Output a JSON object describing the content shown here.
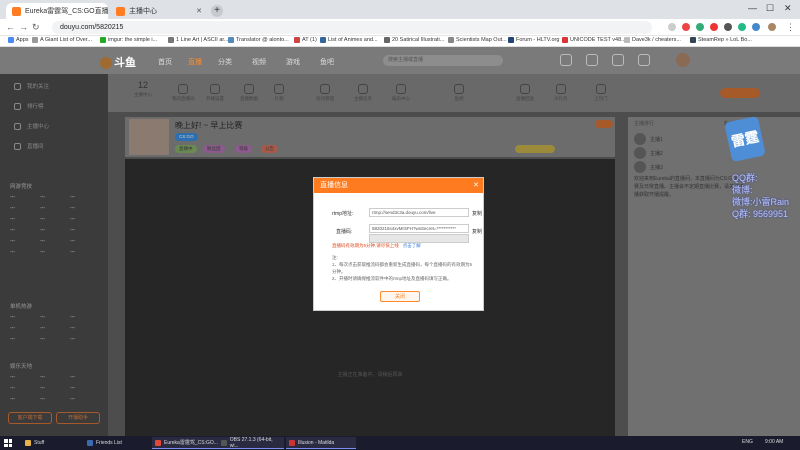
{
  "browser": {
    "tabs": [
      {
        "title": "Eureka雷霆驾_CS:GO直播_斗鱼直播",
        "active": true
      },
      {
        "title": "主播中心",
        "active": false
      }
    ],
    "new_tab": "+",
    "url": "douyu.com/5820215",
    "win_controls": [
      "—",
      "☐",
      "✕"
    ]
  },
  "bookmarks": [
    "Apps",
    "A Giant List of Over...",
    "imgur: the simple i...",
    "1 Line Art | ASCII ar...",
    "Translator @ alonto...",
    "AT (1)",
    "List of Animes and...",
    "20 Satirical Illustrati...",
    "Scientists Map Out...",
    "Forum - HLTV.org",
    "UNICODE TEST v48...",
    "Dave3k / cheaters...",
    "SteamRep » LoL Bo..."
  ],
  "site": {
    "logo": "斗鱼",
    "nav": [
      "首页",
      "直播",
      "分类",
      "视频",
      "游戏",
      "鱼吧"
    ],
    "search_placeholder": "搜索主播或直播"
  },
  "sidebar": {
    "items": [
      "我的关注",
      "排行榜",
      "主播中心",
      "直播间"
    ],
    "section_heads": [
      "网游竞技",
      "单机热游",
      "娱乐天地"
    ],
    "buttons": [
      "客户端下载",
      "开播助手"
    ]
  },
  "category_count": "12",
  "categories": [
    "主播中心",
    "我的直播间",
    "开播设置",
    "直播数据",
    "礼物",
    "房间管理",
    "主播任务",
    "娱乐中心",
    "鱼吧",
    "直播回放",
    "大礼包",
    "上热门"
  ],
  "room": {
    "title": "晚上好! ~ 早上比赛",
    "tags": [
      "CS:GO",
      "粉丝团",
      "等级",
      "公告"
    ],
    "status": "直播中"
  },
  "right_panel": {
    "tabs": [
      "主播排行",
      "粉丝排行"
    ],
    "ranks": [
      "主播1",
      "主播2",
      "主播3"
    ],
    "body": "欢迎来到Eureka的直播间，本直播间为CS:GO比赛及日常直播。主播会不定期直播比赛，请关注主播获取开播提醒。"
  },
  "overlay": {
    "stamp": "雷霆",
    "lines": [
      "QQ群:",
      "微博:",
      "微博:小雷Rain",
      "Q群: 9569951"
    ]
  },
  "dialog": {
    "title": "直播信息",
    "close": "✕",
    "rtmp_label": "rtmp地址:",
    "rtmp_value": "rtmp://send3c3a.douyu.com/live",
    "key_label": "直播码:",
    "key_value": "5820215s4xvMrSFH?wsSecret=***********",
    "copy": "复制",
    "warning": "直播码有效期为5分钟,请尽快上线",
    "warning_link": "点击了解",
    "notes_title": "注:",
    "notes": [
      "1、每次点击获取推流码都会重新生成直播码，每个直播码的有效期为5分钟。",
      "2、开播时请确保推流软件中的rtmp地址及直播码填写正确。"
    ],
    "ok": "关闭"
  },
  "video": {
    "hint": "主播正在准备中，请稍后再来"
  },
  "taskbar": {
    "items": [
      "Stuff",
      "Friends List",
      "Eureka雷霆驾_CS:GO...",
      "OBS 27.1.3 (64-bit, wi...",
      "Illusion - Matilda"
    ],
    "lang": "ENG",
    "time": "9:00 AM"
  }
}
